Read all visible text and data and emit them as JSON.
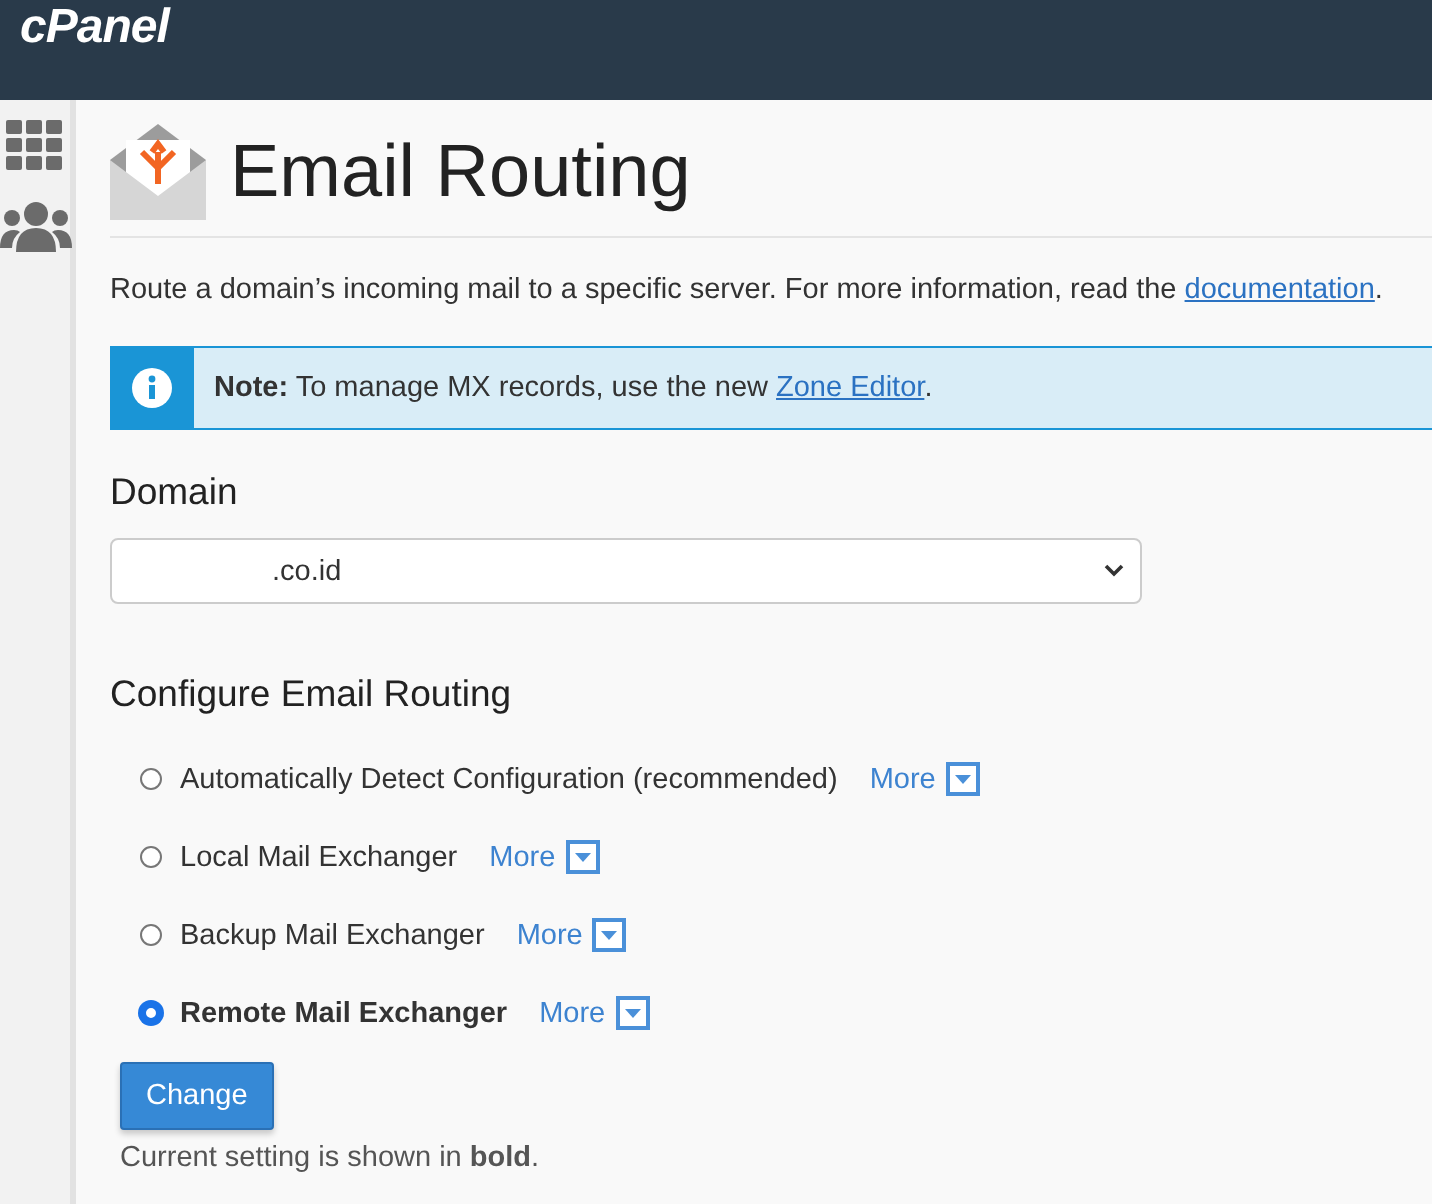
{
  "header": {
    "logo": "cPanel"
  },
  "page": {
    "title": "Email Routing"
  },
  "intro": {
    "text": "Route a domain’s incoming mail to a specific server. For more information, read the ",
    "link": "documentation",
    "after": "."
  },
  "note": {
    "text": "**Note:** To manage MX records, use the new ",
    "link": "Zone Editor",
    "after": "."
  },
  "domain": {
    "label": "Domain",
    "value": ".co.id"
  },
  "routing": {
    "heading": "Configure Email Routing",
    "options": [
      {
        "label": "Automatically Detect Configuration (recommended)",
        "more": "More",
        "selected": false
      },
      {
        "label": "Local Mail Exchanger",
        "more": "More",
        "selected": false
      },
      {
        "label": "Backup Mail Exchanger",
        "more": "More",
        "selected": false
      },
      {
        "label": "Remote Mail Exchanger",
        "more": "More",
        "selected": true
      }
    ],
    "button": "Change",
    "footnote": "Current setting is shown in **bold**."
  }
}
